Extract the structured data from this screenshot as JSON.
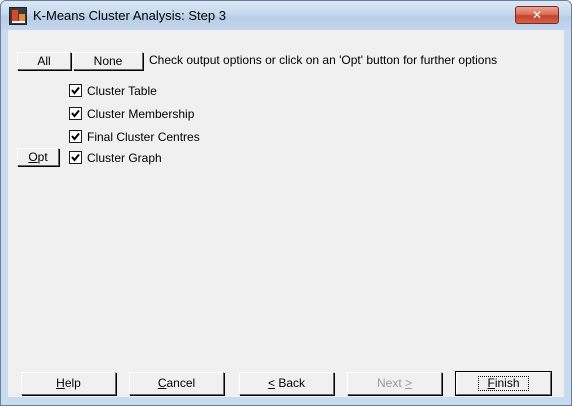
{
  "window": {
    "title": "K-Means Cluster Analysis: Step 3",
    "close_symbol": "✕"
  },
  "top_bar": {
    "all_label": "All",
    "none_label": "None",
    "instructions": "Check output options or click on an 'Opt' button for further options"
  },
  "options": [
    {
      "label": "Cluster Table",
      "checked": true,
      "has_opt": false
    },
    {
      "label": "Cluster Membership",
      "checked": true,
      "has_opt": false
    },
    {
      "label": "Final Cluster Centres",
      "checked": true,
      "has_opt": false
    },
    {
      "label": "Cluster Graph",
      "checked": true,
      "has_opt": true
    }
  ],
  "opt_button": {
    "label_first": "O",
    "label_rest": "pt"
  },
  "footer": {
    "help": {
      "mnemonic": "H",
      "rest": "elp"
    },
    "cancel": {
      "mnemonic": "C",
      "rest": "ancel"
    },
    "back": {
      "mnemonic": "<",
      "rest": " Back"
    },
    "next": {
      "text": "Next ",
      "mnemonic": ">"
    },
    "finish": {
      "mnemonic": "F",
      "rest": "inish"
    }
  },
  "icons": {
    "app": "cluster-chart-app-icon",
    "close": "close-icon",
    "check": "checkmark-icon"
  },
  "colors": {
    "title_bar": "#c6d9ee",
    "close_button": "#c4442b",
    "dialog_face": "#f0f0f0"
  }
}
